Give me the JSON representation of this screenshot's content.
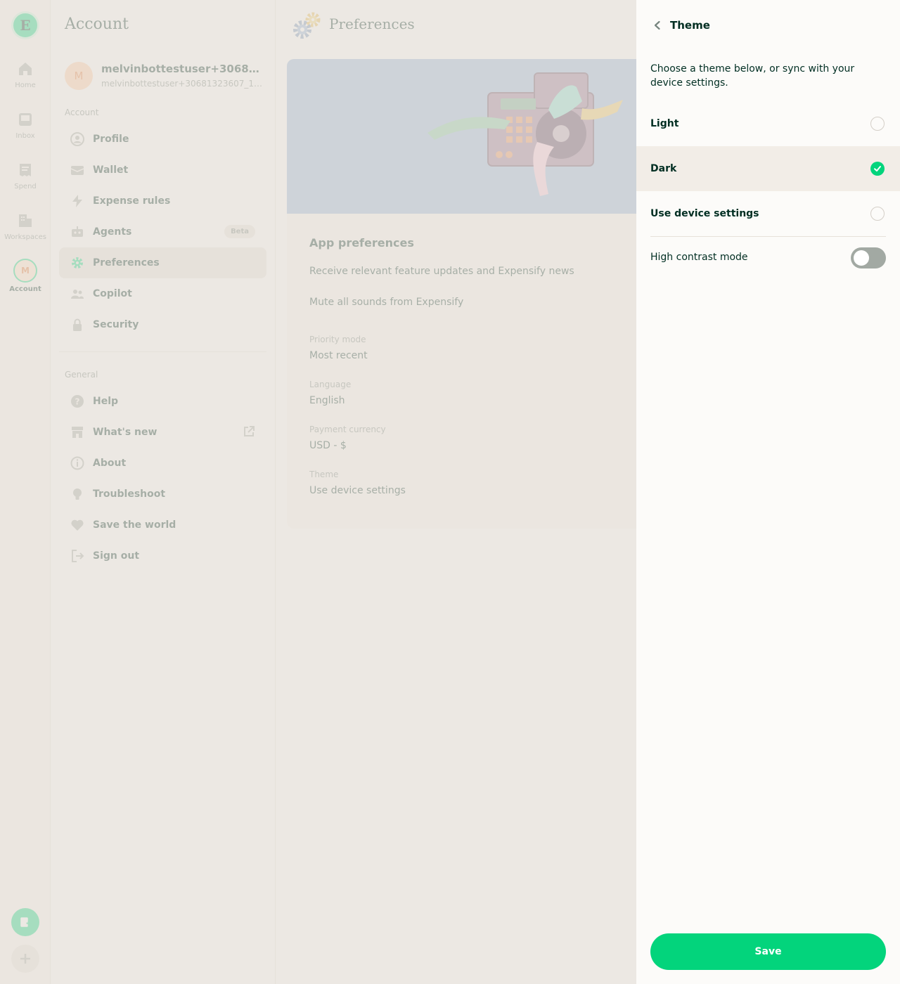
{
  "rail": {
    "items": [
      {
        "label": "Home",
        "icon": "home-icon"
      },
      {
        "label": "Inbox",
        "icon": "inbox-icon"
      },
      {
        "label": "Spend",
        "icon": "receipt-icon"
      },
      {
        "label": "Workspaces",
        "icon": "building-icon"
      },
      {
        "label": "Account",
        "icon": "avatar",
        "avatar_initial": "M"
      }
    ],
    "logo": "E"
  },
  "account": {
    "title": "Account",
    "user": {
      "initial": "M",
      "name": "melvinbottestuser+3068132...",
      "email": "melvinbottestuser+30681323607_1_we..."
    },
    "section_account": "Account",
    "items": [
      {
        "label": "Profile",
        "icon": "profile-icon"
      },
      {
        "label": "Wallet",
        "icon": "wallet-icon"
      },
      {
        "label": "Expense rules",
        "icon": "lightning-icon"
      },
      {
        "label": "Agents",
        "icon": "agent-icon",
        "badge": "Beta"
      },
      {
        "label": "Preferences",
        "icon": "gear-icon",
        "active": true
      },
      {
        "label": "Copilot",
        "icon": "users-icon"
      },
      {
        "label": "Security",
        "icon": "lock-icon"
      }
    ],
    "section_general": "General",
    "general_items": [
      {
        "label": "Help",
        "icon": "question-icon"
      },
      {
        "label": "What's new",
        "icon": "store-icon"
      },
      {
        "label": "About",
        "icon": "info-icon"
      },
      {
        "label": "Troubleshoot",
        "icon": "lightbulb-icon"
      },
      {
        "label": "Save the world",
        "icon": "heart-icon"
      },
      {
        "label": "Sign out",
        "icon": "sign-out-icon"
      }
    ]
  },
  "preferences": {
    "title": "Preferences",
    "heading": "App preferences",
    "line1": "Receive relevant feature updates and Expensify news",
    "line2": "Mute all sounds from Expensify",
    "fields": [
      {
        "label": "Priority mode",
        "value": "Most recent"
      },
      {
        "label": "Language",
        "value": "English"
      },
      {
        "label": "Payment currency",
        "value": "USD - $"
      },
      {
        "label": "Theme",
        "value": "Use device settings"
      }
    ]
  },
  "theme_panel": {
    "title": "Theme",
    "description": "Choose a theme below, or sync with your device settings.",
    "options": [
      {
        "label": "Light",
        "selected": false
      },
      {
        "label": "Dark",
        "selected": true
      },
      {
        "label": "Use device settings",
        "selected": false
      }
    ],
    "high_contrast_label": "High contrast mode",
    "high_contrast_on": false,
    "save_label": "Save"
  },
  "colors": {
    "accent": "#03d47c",
    "text": "#002e22",
    "muted": "#76847e",
    "hero": "#8fb0d6"
  }
}
